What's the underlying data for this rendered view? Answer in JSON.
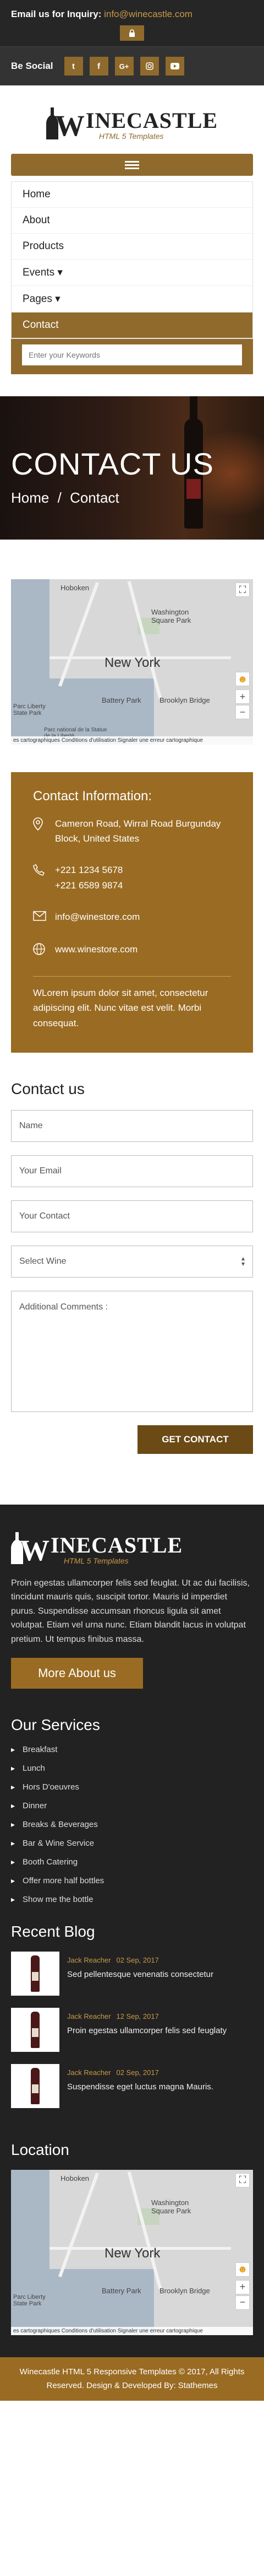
{
  "topbar": {
    "inquiry_label": "Email us for Inquiry:",
    "inquiry_email": "info@winecastle.com",
    "social_label": "Be Social",
    "social_icons": [
      "twitter-icon",
      "facebook-icon",
      "google-plus-icon",
      "instagram-icon",
      "youtube-icon"
    ]
  },
  "brand": {
    "logo_letter": "W",
    "logo_name": "INECASTLE",
    "tagline": "HTML 5 Templates"
  },
  "menu": {
    "items": [
      "Home",
      "About",
      "Products",
      "Events ▾",
      "Pages ▾",
      "Contact"
    ],
    "active": "Contact",
    "search_placeholder": "Enter your Keywords"
  },
  "banner": {
    "title": "CONTACT US",
    "crumb_home": "Home",
    "crumb_sep": "/",
    "crumb_current": "Contact"
  },
  "map": {
    "labels": [
      "Hoboken",
      "Washington Square Park",
      "New York",
      "Battery Park",
      "Brooklyn Bridge",
      "Parc Liberty State Park",
      "Parc national de la Statue de la Liberté"
    ],
    "footer": "es cartographiques   Conditions d'utilisation   Signaler une erreur cartographique"
  },
  "contact_info": {
    "title": "Contact Information:",
    "address": "Cameron Road, Wirral Road Burgunday Block, United States",
    "phone1": "+221 1234 5678",
    "phone2": "+221 6589 9874",
    "email": "info@winestore.com",
    "website": "www.winestore.com",
    "about": "WLorem ipsum dolor sit amet, consectetur adipiscing elit. Nunc vitae est velit. Morbi consequat."
  },
  "form": {
    "title": "Contact us",
    "name_placeholder": "Name",
    "email_placeholder": "Your Email",
    "contact_placeholder": "Your Contact",
    "select_value": "Select Wine",
    "comments_placeholder": "Additional Comments :",
    "submit": "GET CONTACT"
  },
  "footer": {
    "about": "Proin egestas ullamcorper felis sed feuglat. Ut ac dui facilisis, tincidunt mauris quis, suscipit tortor. Mauris id imperdiet purus. Suspendisse accumsan rhoncus ligula sit amet volutpat. Etiam vel urna nunc. Etiam blandit lacus in volutpat pretium. Ut tempus finibus massa.",
    "more_button": "More About us",
    "services_title": "Our Services",
    "services": [
      "Breakfast",
      "Lunch",
      "Hors D'oeuvres",
      "Dinner",
      "Breaks & Beverages",
      "Bar & Wine Service",
      "Booth Catering",
      "Offer more half bottles",
      "Show me the bottle"
    ],
    "blog_title": "Recent Blog",
    "posts": [
      {
        "author": "Jack Reacher",
        "date": "02 Sep, 2017",
        "title": "Sed pellentesque venenatis consectetur"
      },
      {
        "author": "Jack Reacher",
        "date": "12 Sep, 2017",
        "title": "Proin egestas ullamcorper felis sed feuglaty"
      },
      {
        "author": "Jack Reacher",
        "date": "02 Sep, 2017",
        "title": "Suspendisse eget luctus magna Mauris."
      }
    ],
    "location_title": "Location",
    "copyright": "Winecastle HTML 5 Responsive Templates © 2017, All Rights Reserved. Design & Developed By: Stathemes"
  },
  "colors": {
    "accent": "#9a6b22",
    "dark": "#222222"
  }
}
